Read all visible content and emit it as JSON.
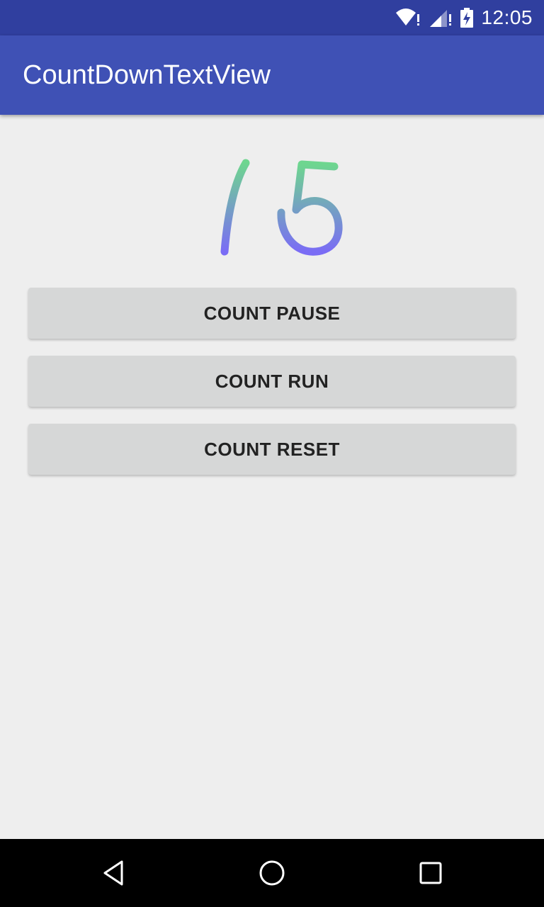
{
  "status_bar": {
    "time": "12:05",
    "icons": [
      "wifi-alert-icon",
      "signal-alert-icon",
      "battery-charging-icon"
    ]
  },
  "app_bar": {
    "title": "CountDownTextView",
    "color": "#3f51b5",
    "status_color": "#303f9f"
  },
  "countdown": {
    "value": "15",
    "gradient_top": "#6ed68f",
    "gradient_bottom": "#7a6cf5"
  },
  "buttons": {
    "pause": "COUNT PAUSE",
    "run": "COUNT RUN",
    "reset": "COUNT RESET"
  },
  "nav_bar": {
    "icons": [
      "back-icon",
      "home-icon",
      "recents-icon"
    ]
  }
}
